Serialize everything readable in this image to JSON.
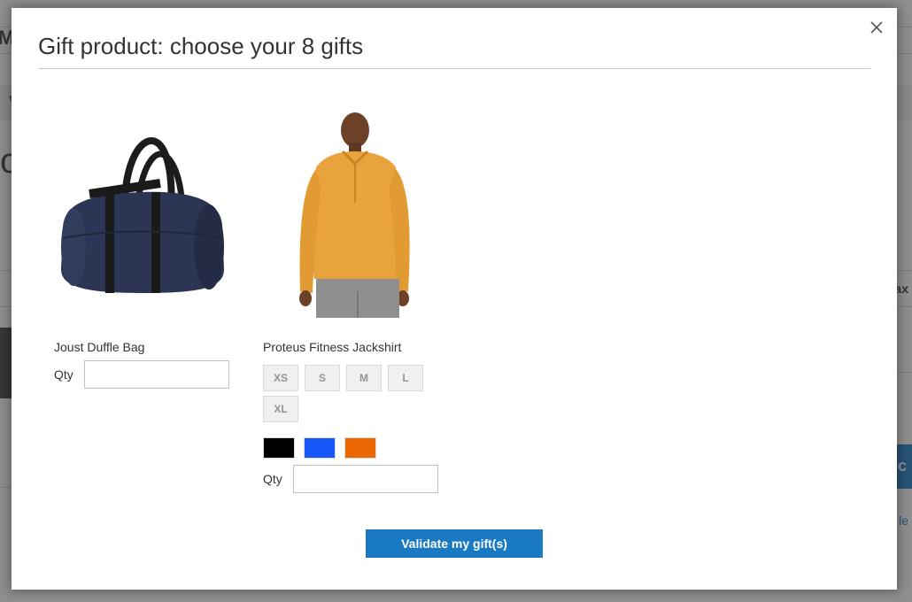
{
  "background": {
    "logo_fragment": "M",
    "nav_fragment": "V",
    "heading_fragment": "o",
    "right_label_fragment": "ax",
    "right_button_fragment": "ec",
    "right_link_fragment": "le"
  },
  "modal": {
    "title": "Gift product: choose your 8 gifts",
    "close_icon": "close-icon"
  },
  "products": [
    {
      "name": "Joust Duffle Bag",
      "image": "duffle-bag-image",
      "qty_label": "Qty",
      "qty_value": ""
    },
    {
      "name": "Proteus Fitness Jackshirt",
      "image": "jackshirt-image",
      "sizes": [
        "XS",
        "S",
        "M",
        "L",
        "XL"
      ],
      "colors": [
        "#000000",
        "#1857f7",
        "#eb6703"
      ],
      "qty_label": "Qty",
      "qty_value": ""
    }
  ],
  "actions": {
    "validate_label": "Validate my gift(s)"
  },
  "colors": {
    "accent": "#1979c3",
    "overlay": "rgba(51,51,51,0.55)"
  }
}
